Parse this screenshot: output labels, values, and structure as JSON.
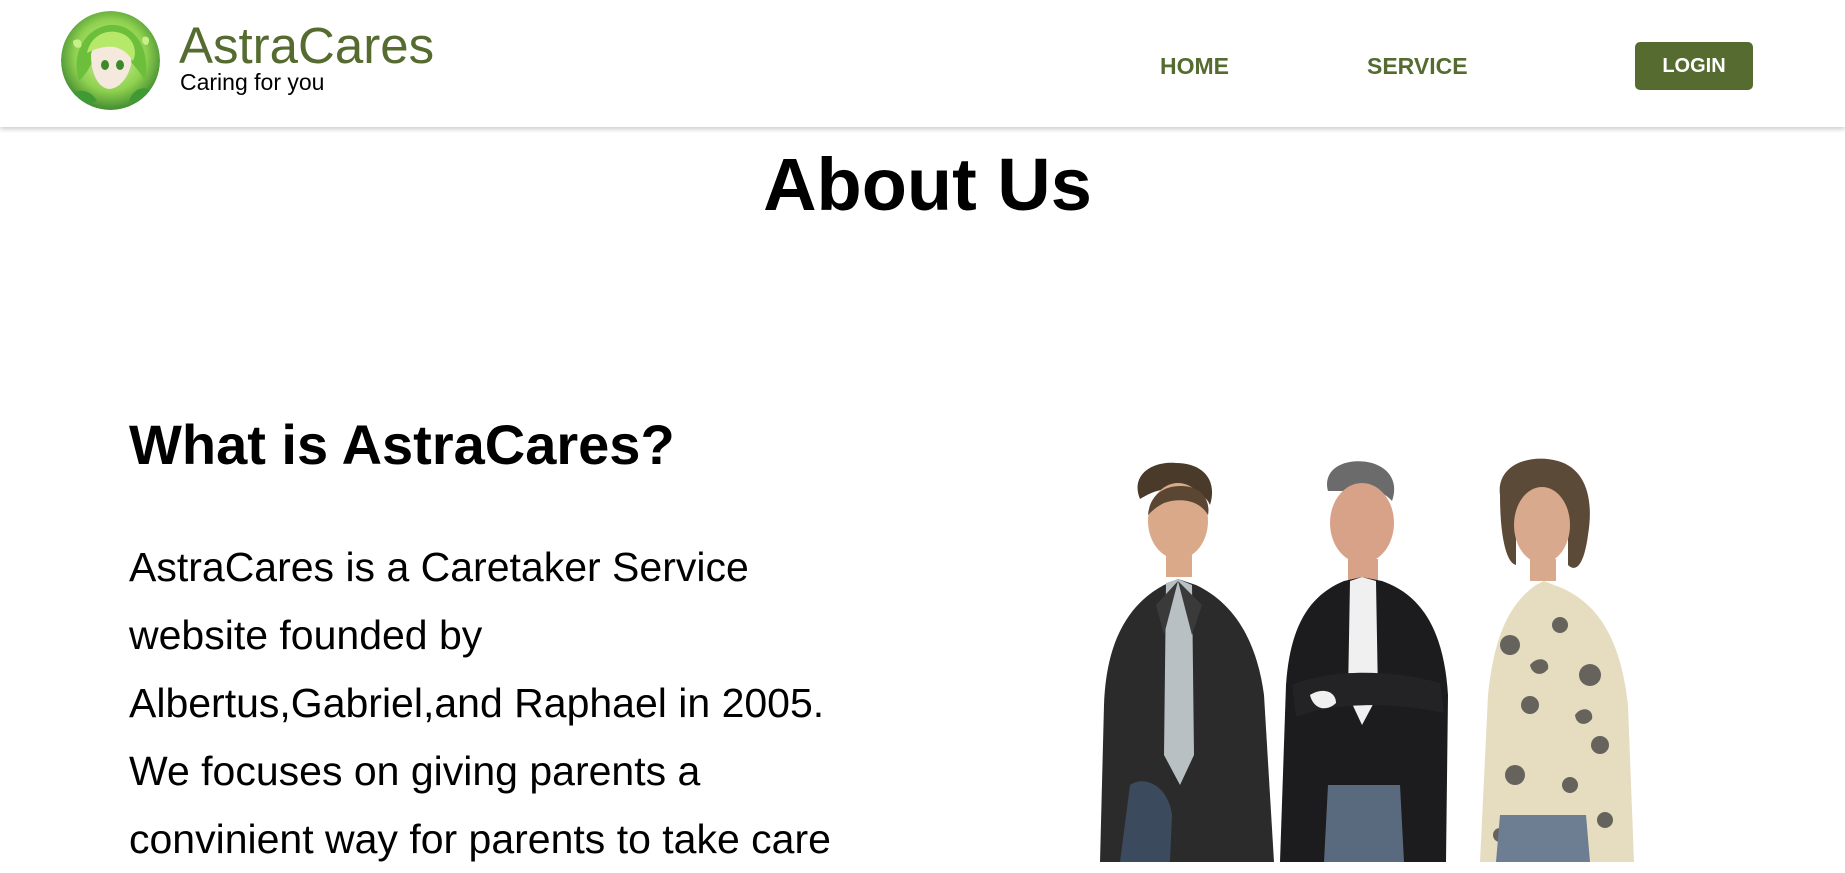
{
  "navbar": {
    "brand_name": "AstraCares",
    "brand_tagline": "Caring for you",
    "links": [
      {
        "label": "HOME"
      },
      {
        "label": "SERVICE"
      }
    ],
    "login_label": "LOGIN"
  },
  "colors": {
    "accent": "#556b2f",
    "text": "#000000",
    "background": "#ffffff"
  },
  "main": {
    "title": "About Us",
    "section_heading": "What is AstraCares?",
    "body_lines": [
      "AstraCares is a Caretaker Service",
      "website founded by",
      "Albertus,Gabriel,and Raphael in 2005.",
      "We focuses on giving parents a",
      "convinient way for parents to take care"
    ]
  }
}
